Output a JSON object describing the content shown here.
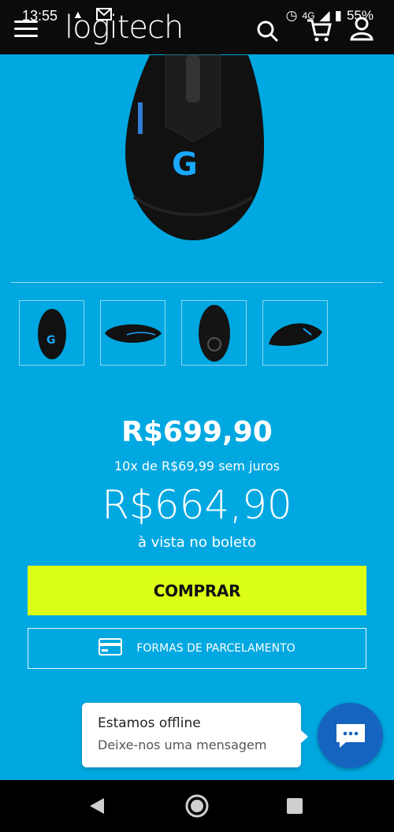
{
  "status_bar": {
    "time": "13:55",
    "network": "4G",
    "battery": "55%"
  },
  "header": {
    "logo": "logitech",
    "icons": [
      "menu-icon",
      "search-icon",
      "cart-icon",
      "user-icon"
    ]
  },
  "product": {
    "thumbnails": [
      "thumbnail-top-view",
      "thumbnail-side-view",
      "thumbnail-bottom-view",
      "thumbnail-angle-view"
    ]
  },
  "pricing": {
    "list_price": "R$699,90",
    "installments": "10x de R$69,99 sem juros",
    "cash_price": "R$664,90",
    "cash_note": "à vista no boleto"
  },
  "actions": {
    "buy_label": "COMPRAR",
    "installments_label": "FORMAS DE PARCELAMENTO"
  },
  "chat": {
    "title": "Estamos offline",
    "subtitle": "Deixe-nos uma mensagem"
  },
  "colors": {
    "background": "#00a8e1",
    "buy_button": "#dcff16",
    "chat_button": "#1565c0"
  }
}
